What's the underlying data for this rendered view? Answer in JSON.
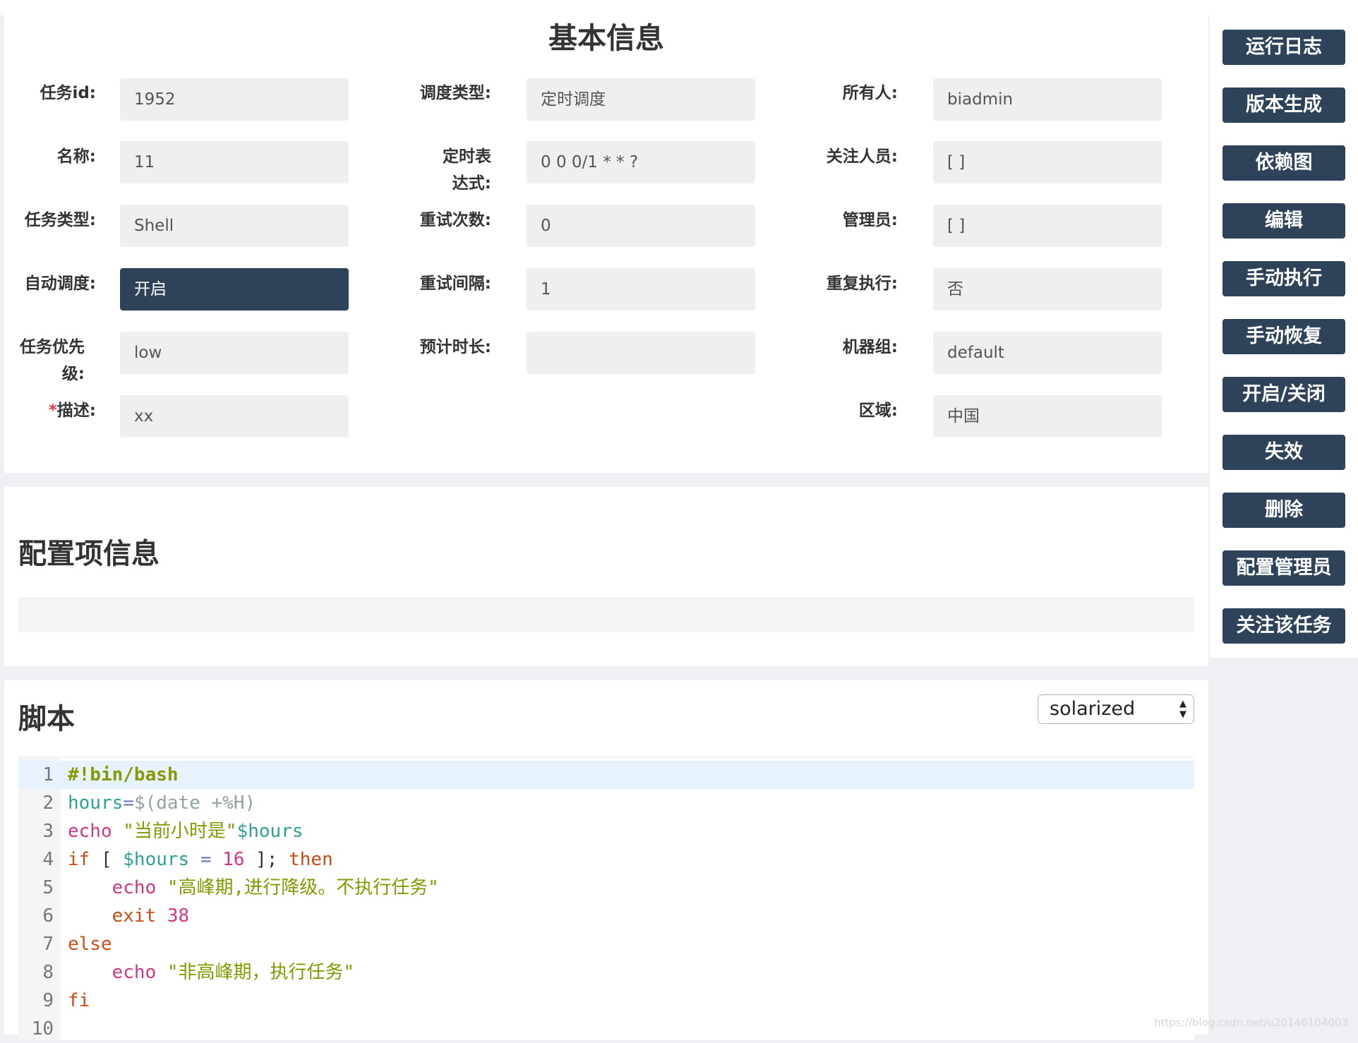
{
  "basic": {
    "title": "基本信息",
    "fields": [
      {
        "label": "任务id:",
        "value": "1952"
      },
      {
        "label": "名称:",
        "value": "11"
      },
      {
        "label": "任务类型:",
        "value": "Shell"
      },
      {
        "label": "自动调度:",
        "value": "开启"
      },
      {
        "label": "任务优先级:",
        "value": "low"
      },
      {
        "label": "描述:",
        "label_required_mark": "*",
        "value": "xx"
      },
      {
        "label": "调度类型:",
        "value": "定时调度"
      },
      {
        "label": "定时表达式:",
        "value": "0 0 0/1 * * ?"
      },
      {
        "label": "重试次数:",
        "value": "0"
      },
      {
        "label": "重试间隔:",
        "value": "1"
      },
      {
        "label": "预计时长:",
        "value": ""
      },
      {
        "label": "所有人:",
        "value": "biadmin"
      },
      {
        "label": "关注人员:",
        "value": "[ ]"
      },
      {
        "label": "管理员:",
        "value": "[ ]"
      },
      {
        "label": "重复执行:",
        "value": "否"
      },
      {
        "label": "机器组:",
        "value": "default"
      },
      {
        "label": "区域:",
        "value": "中国"
      }
    ]
  },
  "config": {
    "title": "配置项信息"
  },
  "script": {
    "title": "脚本",
    "theme_selected": "solarized",
    "line_numbers": [
      "1",
      "2",
      "3",
      "4",
      "5",
      "6",
      "7",
      "8",
      "9",
      "10"
    ],
    "lines": [
      {
        "t1": "#!bin/bash"
      },
      {
        "t1": "hours",
        "t2": "=",
        "t3": "$(date +%H)"
      },
      {
        "t1": "echo",
        "t2": " \"当前小时是\"",
        "t3": "$hours"
      },
      {
        "t1": "if",
        "t2": " [ ",
        "t3": "$hours",
        "t4": " = ",
        "t5": "16",
        "t6": " ]; ",
        "t7": "then"
      },
      {
        "t1": "    echo",
        "t2": " \"高峰期,进行降级。不执行任务\""
      },
      {
        "t1": "    exit",
        "t2": " 38"
      },
      {
        "t1": "else"
      },
      {
        "t1": "    echo",
        "t2": " \"非高峰期，执行任务\""
      },
      {
        "t1": "fi"
      },
      {
        "t1": ""
      }
    ]
  },
  "sidebar": {
    "buttons": [
      "运行日志",
      "版本生成",
      "依赖图",
      "编辑",
      "手动执行",
      "手动恢复",
      "开启/关闭",
      "失效",
      "删除",
      "配置管理员",
      "关注该任务"
    ]
  },
  "watermark": "https://blog.csdn.net/u20146104003",
  "colors": {
    "dark_accent": "#2e4259",
    "field_bg": "#efefef",
    "page_bg": "#eef0f4"
  }
}
